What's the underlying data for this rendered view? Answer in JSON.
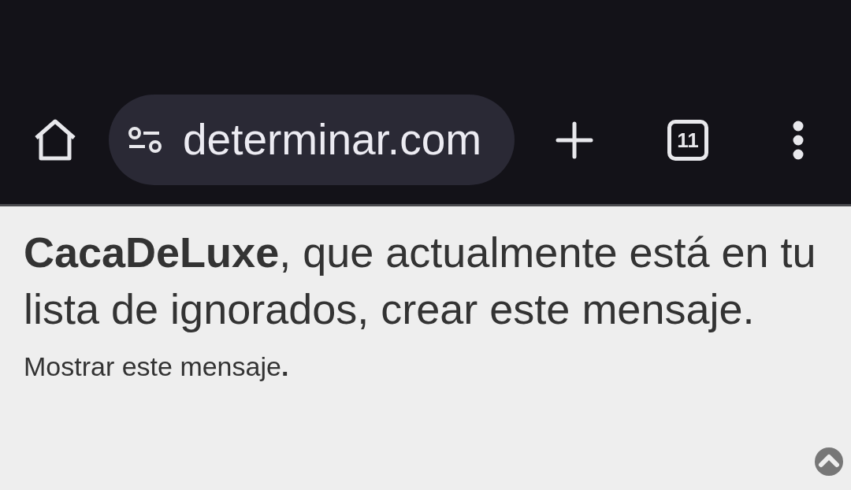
{
  "toolbar": {
    "url": "determinar.com",
    "tab_count": "11"
  },
  "message": {
    "notice": "**CacaDeLuxe**, que actualmente está en tu lista de ignorados, crear este mensaje.",
    "show_link": "Mostrar este mensaje**.**"
  }
}
